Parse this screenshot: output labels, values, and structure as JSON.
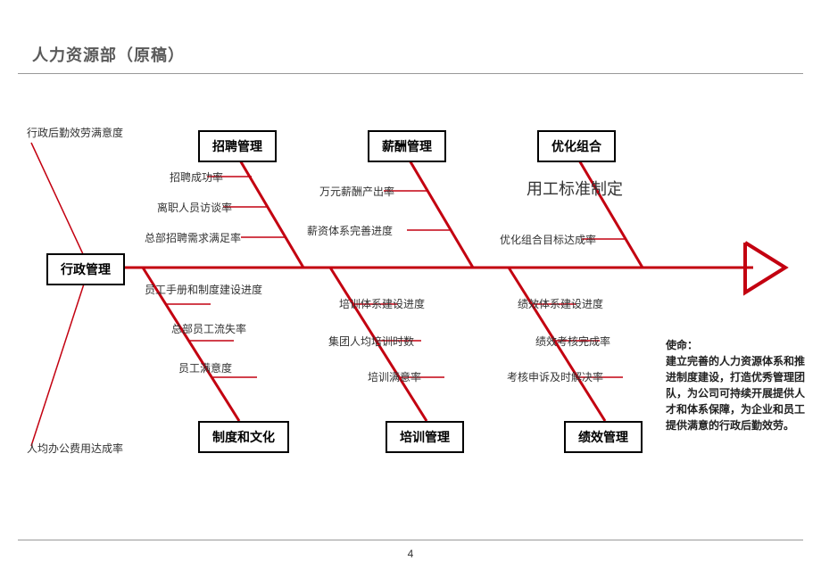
{
  "page": {
    "title": "人力资源部（原稿）",
    "number": "4"
  },
  "head_box": "行政管理",
  "top_left_label": "行政后勤效劳满意度",
  "bottom_left_label": "人均办公费用达成率",
  "top_branches": [
    {
      "name": "招聘管理",
      "items": [
        "招聘成功率",
        "离职人员访谈率",
        "总部招聘需求满足率"
      ]
    },
    {
      "name": "薪酬管理",
      "items": [
        "万元薪酬产出率",
        "薪资体系完善进度"
      ]
    },
    {
      "name": "优化组合",
      "big_label": "用工标准制定",
      "items": [
        "优化组合目标达成率"
      ]
    }
  ],
  "bottom_branches": [
    {
      "name": "制度和文化",
      "items": [
        "员工手册和制度建设进度",
        "总部员工流失率",
        "员工满意度"
      ]
    },
    {
      "name": "培训管理",
      "items": [
        "培训体系建设进度",
        "集团人均培训时数",
        "培训满意率"
      ]
    },
    {
      "name": "绩效管理",
      "items": [
        "绩效体系建设进度",
        "绩效考核完成率",
        "考核申诉及时解决率"
      ]
    }
  ],
  "mission": {
    "heading": "使命：",
    "body": "建立完善的人力资源体系和推进制度建设，打造优秀管理团队，为公司可持续开展提供人才和体系保障，为企业和员工提供满意的行政后勤效劳。"
  }
}
